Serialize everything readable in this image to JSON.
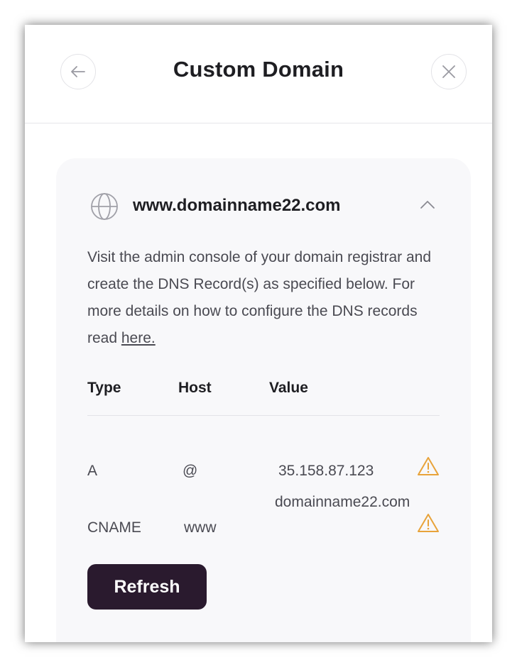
{
  "dialog": {
    "title": "Custom Domain"
  },
  "domain_card": {
    "domain": "www.domainname22.com",
    "description": "Visit the admin console of your domain registrar and create the DNS Record(s) as specified below. For more details on how to configure the DNS records read ",
    "link_text": "here.",
    "table": {
      "headers": [
        "Type",
        "Host",
        "Value"
      ],
      "rows": [
        {
          "type": "A",
          "host": "@",
          "value": "35.158.87.123",
          "status": "warning"
        },
        {
          "type": "CNAME",
          "host": "www",
          "value": "domainname22.com",
          "status": "warning"
        }
      ]
    },
    "refresh_label": "Refresh"
  },
  "icons": {
    "back": "arrow-left-icon",
    "close": "close-icon",
    "globe": "globe-icon",
    "collapse": "chevron-up-icon",
    "warning": "warning-triangle-icon"
  },
  "colors": {
    "primary_button": "#2a1a2e",
    "warning": "#e8a33a",
    "card_background": "#f8f8fa"
  }
}
